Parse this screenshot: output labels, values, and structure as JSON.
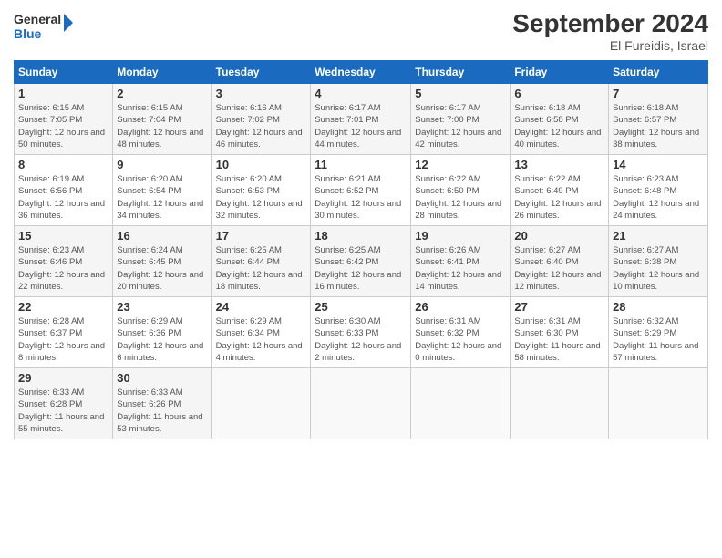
{
  "header": {
    "logo_general": "General",
    "logo_blue": "Blue",
    "month_title": "September 2024",
    "subtitle": "El Fureidis, Israel"
  },
  "days_of_week": [
    "Sunday",
    "Monday",
    "Tuesday",
    "Wednesday",
    "Thursday",
    "Friday",
    "Saturday"
  ],
  "weeks": [
    [
      {
        "day": "1",
        "info": "Sunrise: 6:15 AM\nSunset: 7:05 PM\nDaylight: 12 hours and 50 minutes."
      },
      {
        "day": "2",
        "info": "Sunrise: 6:15 AM\nSunset: 7:04 PM\nDaylight: 12 hours and 48 minutes."
      },
      {
        "day": "3",
        "info": "Sunrise: 6:16 AM\nSunset: 7:02 PM\nDaylight: 12 hours and 46 minutes."
      },
      {
        "day": "4",
        "info": "Sunrise: 6:17 AM\nSunset: 7:01 PM\nDaylight: 12 hours and 44 minutes."
      },
      {
        "day": "5",
        "info": "Sunrise: 6:17 AM\nSunset: 7:00 PM\nDaylight: 12 hours and 42 minutes."
      },
      {
        "day": "6",
        "info": "Sunrise: 6:18 AM\nSunset: 6:58 PM\nDaylight: 12 hours and 40 minutes."
      },
      {
        "day": "7",
        "info": "Sunrise: 6:18 AM\nSunset: 6:57 PM\nDaylight: 12 hours and 38 minutes."
      }
    ],
    [
      {
        "day": "8",
        "info": "Sunrise: 6:19 AM\nSunset: 6:56 PM\nDaylight: 12 hours and 36 minutes."
      },
      {
        "day": "9",
        "info": "Sunrise: 6:20 AM\nSunset: 6:54 PM\nDaylight: 12 hours and 34 minutes."
      },
      {
        "day": "10",
        "info": "Sunrise: 6:20 AM\nSunset: 6:53 PM\nDaylight: 12 hours and 32 minutes."
      },
      {
        "day": "11",
        "info": "Sunrise: 6:21 AM\nSunset: 6:52 PM\nDaylight: 12 hours and 30 minutes."
      },
      {
        "day": "12",
        "info": "Sunrise: 6:22 AM\nSunset: 6:50 PM\nDaylight: 12 hours and 28 minutes."
      },
      {
        "day": "13",
        "info": "Sunrise: 6:22 AM\nSunset: 6:49 PM\nDaylight: 12 hours and 26 minutes."
      },
      {
        "day": "14",
        "info": "Sunrise: 6:23 AM\nSunset: 6:48 PM\nDaylight: 12 hours and 24 minutes."
      }
    ],
    [
      {
        "day": "15",
        "info": "Sunrise: 6:23 AM\nSunset: 6:46 PM\nDaylight: 12 hours and 22 minutes."
      },
      {
        "day": "16",
        "info": "Sunrise: 6:24 AM\nSunset: 6:45 PM\nDaylight: 12 hours and 20 minutes."
      },
      {
        "day": "17",
        "info": "Sunrise: 6:25 AM\nSunset: 6:44 PM\nDaylight: 12 hours and 18 minutes."
      },
      {
        "day": "18",
        "info": "Sunrise: 6:25 AM\nSunset: 6:42 PM\nDaylight: 12 hours and 16 minutes."
      },
      {
        "day": "19",
        "info": "Sunrise: 6:26 AM\nSunset: 6:41 PM\nDaylight: 12 hours and 14 minutes."
      },
      {
        "day": "20",
        "info": "Sunrise: 6:27 AM\nSunset: 6:40 PM\nDaylight: 12 hours and 12 minutes."
      },
      {
        "day": "21",
        "info": "Sunrise: 6:27 AM\nSunset: 6:38 PM\nDaylight: 12 hours and 10 minutes."
      }
    ],
    [
      {
        "day": "22",
        "info": "Sunrise: 6:28 AM\nSunset: 6:37 PM\nDaylight: 12 hours and 8 minutes."
      },
      {
        "day": "23",
        "info": "Sunrise: 6:29 AM\nSunset: 6:36 PM\nDaylight: 12 hours and 6 minutes."
      },
      {
        "day": "24",
        "info": "Sunrise: 6:29 AM\nSunset: 6:34 PM\nDaylight: 12 hours and 4 minutes."
      },
      {
        "day": "25",
        "info": "Sunrise: 6:30 AM\nSunset: 6:33 PM\nDaylight: 12 hours and 2 minutes."
      },
      {
        "day": "26",
        "info": "Sunrise: 6:31 AM\nSunset: 6:32 PM\nDaylight: 12 hours and 0 minutes."
      },
      {
        "day": "27",
        "info": "Sunrise: 6:31 AM\nSunset: 6:30 PM\nDaylight: 11 hours and 58 minutes."
      },
      {
        "day": "28",
        "info": "Sunrise: 6:32 AM\nSunset: 6:29 PM\nDaylight: 11 hours and 57 minutes."
      }
    ],
    [
      {
        "day": "29",
        "info": "Sunrise: 6:33 AM\nSunset: 6:28 PM\nDaylight: 11 hours and 55 minutes."
      },
      {
        "day": "30",
        "info": "Sunrise: 6:33 AM\nSunset: 6:26 PM\nDaylight: 11 hours and 53 minutes."
      },
      {
        "day": "",
        "info": ""
      },
      {
        "day": "",
        "info": ""
      },
      {
        "day": "",
        "info": ""
      },
      {
        "day": "",
        "info": ""
      },
      {
        "day": "",
        "info": ""
      }
    ]
  ]
}
